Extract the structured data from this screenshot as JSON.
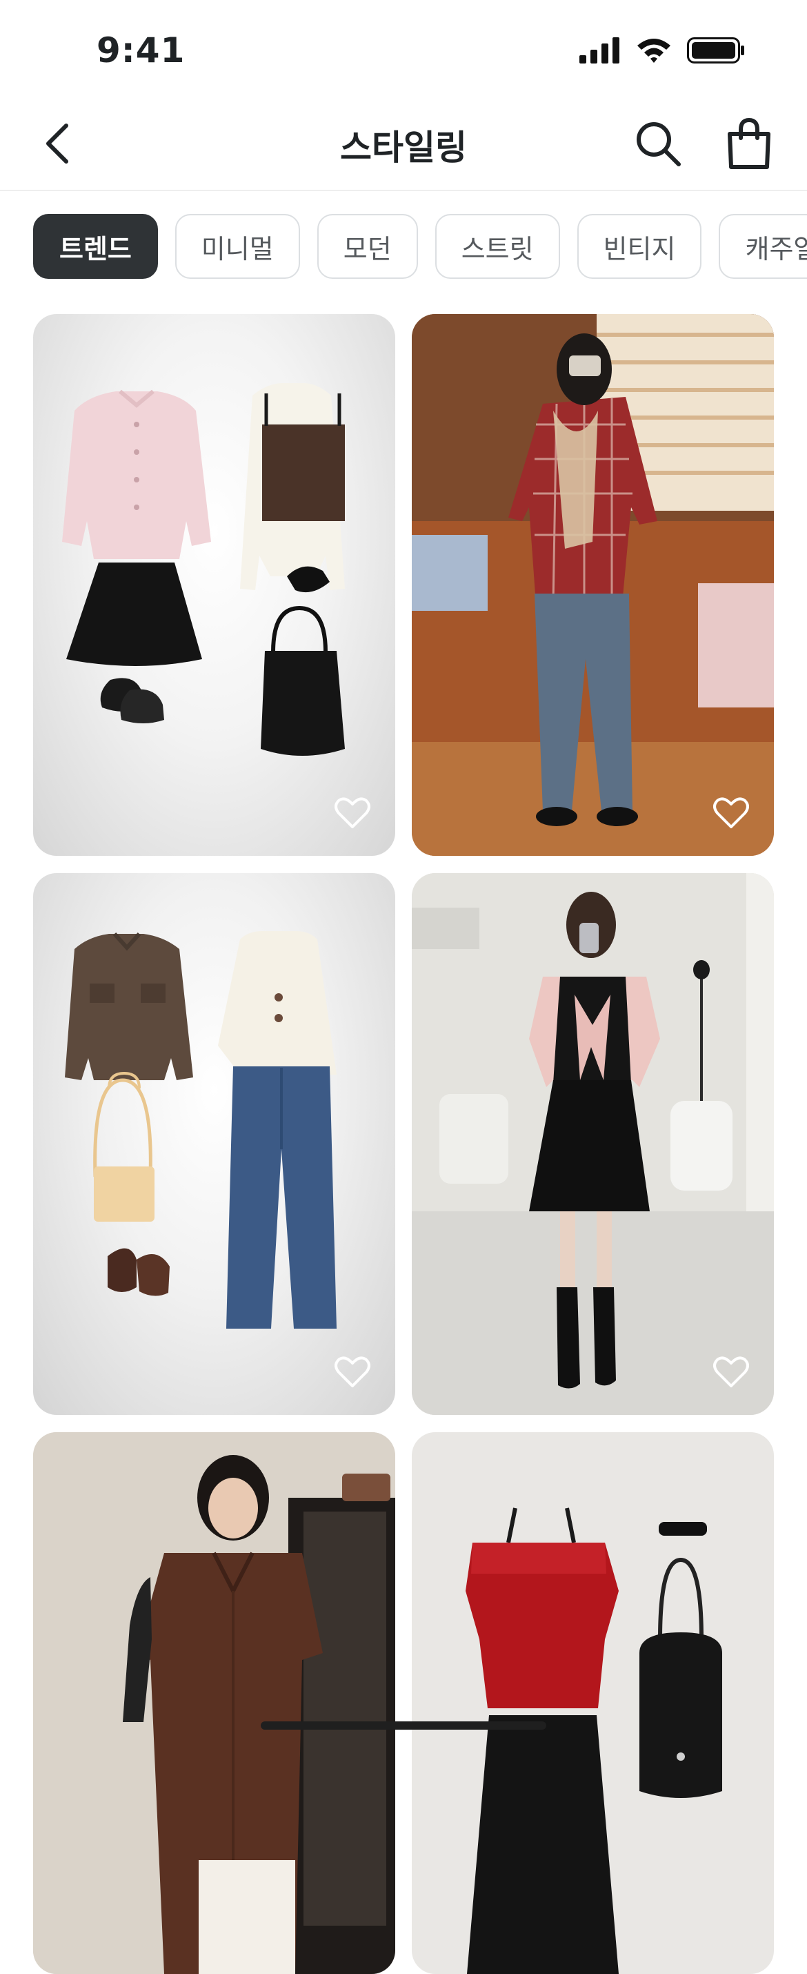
{
  "status_bar": {
    "time": "9:41"
  },
  "header": {
    "title": "스타일링"
  },
  "categories": [
    {
      "label": "트렌드",
      "active": true
    },
    {
      "label": "미니멀",
      "active": false
    },
    {
      "label": "모던",
      "active": false
    },
    {
      "label": "스트릿",
      "active": false
    },
    {
      "label": "빈티지",
      "active": false
    },
    {
      "label": "캐주얼",
      "active": false
    }
  ],
  "feed": [
    {
      "kind": "flatlay"
    },
    {
      "kind": "photo"
    },
    {
      "kind": "flatlay"
    },
    {
      "kind": "photo"
    },
    {
      "kind": "photo"
    },
    {
      "kind": "flatlay"
    }
  ],
  "colors": {
    "accent": "#2f3336",
    "chip_border": "#dcdfe2",
    "text": "#1f2326"
  }
}
